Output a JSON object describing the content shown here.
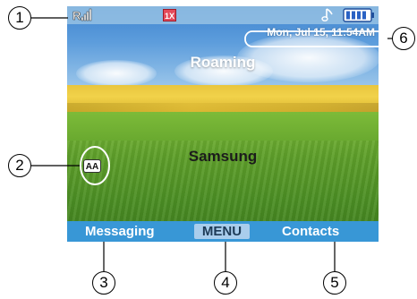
{
  "status_bar": {
    "signal_icon": "signal-strength-icon",
    "network_badge": "1X",
    "ringer_icon": "music-note-icon",
    "battery_icon": "battery-full-icon"
  },
  "datetime": "Mon, Jul 15, 11:54AM",
  "roaming_text": "Roaming",
  "banner_text": "Samsung",
  "aa_badge": "AA",
  "softkeys": {
    "left": "Messaging",
    "center": "MENU",
    "right": "Contacts"
  },
  "callouts": [
    "1",
    "2",
    "3",
    "4",
    "5",
    "6"
  ],
  "colors": {
    "softkey_bar": "#3897d6",
    "menu_highlight": "#a9cdec",
    "network_badge": "#e44a5a",
    "battery": "#2a62c4"
  }
}
